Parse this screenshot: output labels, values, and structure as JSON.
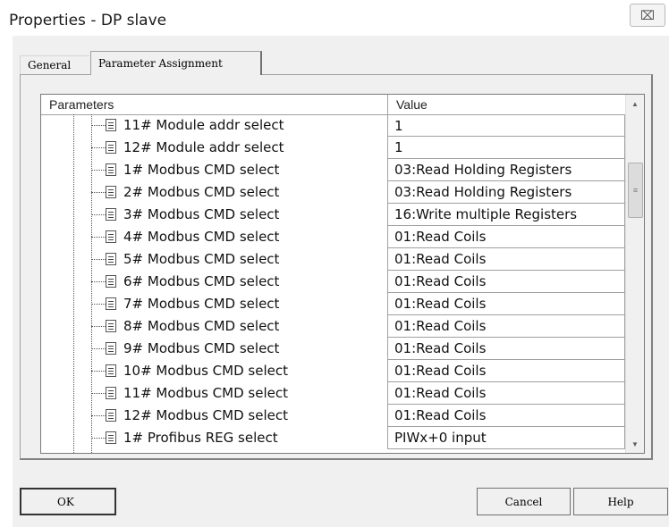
{
  "window": {
    "title": "Properties - DP slave",
    "close_label": "⌧"
  },
  "tabs": [
    {
      "label": "General",
      "active": false
    },
    {
      "label": "Parameter Assignment",
      "active": true
    }
  ],
  "grid": {
    "columns": [
      "Parameters",
      "Value"
    ],
    "rows": [
      {
        "name": "11# Module addr select",
        "value": "1"
      },
      {
        "name": "12# Module addr select",
        "value": "1"
      },
      {
        "name": "1# Modbus CMD select",
        "value": "03:Read Holding Registers"
      },
      {
        "name": "2# Modbus CMD select",
        "value": "03:Read Holding Registers"
      },
      {
        "name": "3# Modbus CMD select",
        "value": "16:Write multiple Registers"
      },
      {
        "name": "4# Modbus CMD select",
        "value": "01:Read Coils"
      },
      {
        "name": "5# Modbus CMD select",
        "value": "01:Read Coils"
      },
      {
        "name": "6# Modbus CMD select",
        "value": "01:Read Coils"
      },
      {
        "name": "7# Modbus CMD select",
        "value": "01:Read Coils"
      },
      {
        "name": "8# Modbus CMD select",
        "value": "01:Read Coils"
      },
      {
        "name": "9# Modbus CMD select",
        "value": "01:Read Coils"
      },
      {
        "name": "10# Modbus CMD select",
        "value": "01:Read Coils"
      },
      {
        "name": "11# Modbus CMD select",
        "value": "01:Read Coils"
      },
      {
        "name": "12# Modbus CMD select",
        "value": "01:Read Coils"
      },
      {
        "name": "1# Profibus REG select",
        "value": "PIWx+0  input"
      }
    ]
  },
  "buttons": {
    "ok": "OK",
    "cancel": "Cancel",
    "help": "Help"
  },
  "icons": {
    "row_icon": "parameter-list-icon",
    "scroll_up": "▲",
    "scroll_down": "▼",
    "thumb_grip": "≡"
  }
}
